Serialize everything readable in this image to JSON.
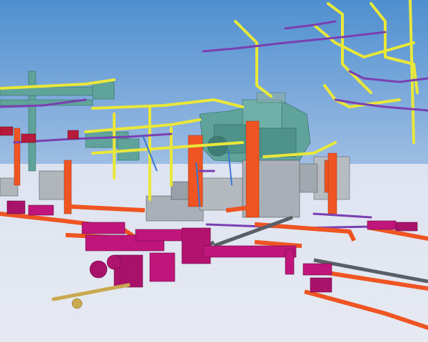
{
  "viewport": {
    "kind": "3D BIM MEP model viewport",
    "colors": {
      "sky_top": "#4f8fcf",
      "sky_bottom": "#dfe4ee",
      "ground": "#e8eaf2",
      "yellow_pipe": "#e9e83a",
      "purple_pipe": "#7a3fb0",
      "orange_pipe": "#ee5522",
      "magenta_pipe": "#c0157a",
      "teal_duct": "#5fa39a",
      "equipment_grey": "#9aa0a8",
      "gray_beam": "#5a5e66",
      "blue_line": "#3a78d0"
    }
  }
}
